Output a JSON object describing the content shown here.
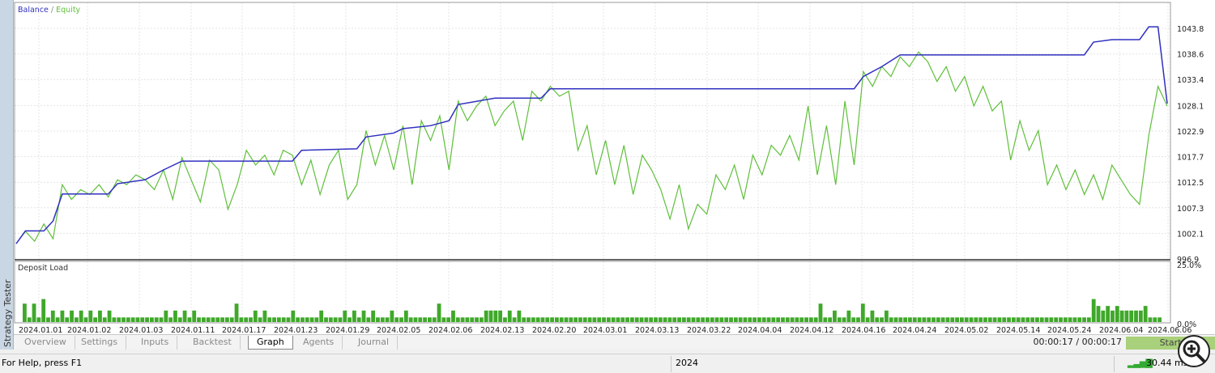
{
  "panel_title": "Strategy Tester",
  "legend": {
    "balance": "Balance",
    "sep": " / ",
    "equity": "Equity"
  },
  "colors": {
    "balance": "#3030c0",
    "equity": "#5fbf3a",
    "bars": "#3fa82a"
  },
  "chart_data": [
    {
      "type": "line",
      "title": "Balance / Equity",
      "yticks": [
        "1043.8",
        "1038.6",
        "1033.4",
        "1028.1",
        "1022.9",
        "1017.7",
        "1012.5",
        "1007.3",
        "1002.1",
        "996.9"
      ],
      "ylim": [
        996.9,
        1043.8
      ],
      "series": [
        {
          "name": "Equity",
          "values": [
            1000,
            1002.5,
            1000.5,
            1004,
            1001,
            1012,
            1009,
            1011,
            1010,
            1012,
            1009.5,
            1013,
            1012,
            1014,
            1013,
            1011,
            1015,
            1009,
            1017.5,
            1013,
            1008.5,
            1017,
            1015,
            1007,
            1012,
            1019,
            1016,
            1018,
            1014,
            1019,
            1018,
            1012,
            1017,
            1010,
            1016,
            1019,
            1009,
            1012,
            1023,
            1016,
            1022,
            1015,
            1024,
            1012,
            1025,
            1021,
            1026,
            1015,
            1029,
            1025,
            1028,
            1030,
            1024,
            1027,
            1029,
            1021,
            1031,
            1029,
            1032,
            1030,
            1031,
            1019,
            1024,
            1014,
            1021,
            1012,
            1020,
            1010,
            1018,
            1015,
            1011,
            1005,
            1012,
            1003,
            1008,
            1006,
            1014,
            1011,
            1016,
            1009,
            1018,
            1014,
            1020,
            1018,
            1022,
            1017,
            1028,
            1014,
            1024,
            1012,
            1029,
            1016,
            1035,
            1032,
            1036,
            1034,
            1038,
            1036,
            1039,
            1037,
            1033,
            1036,
            1031,
            1034,
            1028,
            1032,
            1027,
            1029,
            1017,
            1025,
            1019,
            1023,
            1012,
            1016,
            1011,
            1015,
            1010,
            1014,
            1009,
            1016,
            1013,
            1010,
            1008,
            1022,
            1032,
            1028
          ]
        },
        {
          "name": "Balance",
          "points": [
            [
              0,
              1000
            ],
            [
              1,
              1002.6
            ],
            [
              3,
              1002.6
            ],
            [
              4,
              1004.6
            ],
            [
              5,
              1010.1
            ],
            [
              10,
              1010.1
            ],
            [
              11,
              1012.2
            ],
            [
              14,
              1013
            ],
            [
              16,
              1015
            ],
            [
              18,
              1016.8
            ],
            [
              30,
              1016.8
            ],
            [
              31,
              1019
            ],
            [
              37,
              1019.3
            ],
            [
              38,
              1021.7
            ],
            [
              41,
              1022.5
            ],
            [
              42,
              1023.4
            ],
            [
              45,
              1024
            ],
            [
              47,
              1025
            ],
            [
              48,
              1028.3
            ],
            [
              52,
              1029.6
            ],
            [
              57,
              1029.6
            ],
            [
              58,
              1031.5
            ],
            [
              91,
              1031.5
            ],
            [
              92,
              1034
            ],
            [
              94,
              1036
            ],
            [
              96,
              1038.4
            ],
            [
              116,
              1038.4
            ],
            [
              117,
              1041
            ],
            [
              119,
              1041.5
            ],
            [
              122,
              1041.5
            ],
            [
              123,
              1044.1
            ],
            [
              124,
              1044.1
            ],
            [
              125,
              1028.5
            ]
          ]
        }
      ]
    },
    {
      "type": "bar",
      "title": "Deposit Load",
      "yticks": [
        "25.0%",
        "0.0%"
      ],
      "ylim": [
        0,
        25
      ],
      "values": [
        8,
        2,
        8,
        2,
        10,
        2,
        5,
        2,
        5,
        2,
        5,
        2,
        5,
        2,
        5,
        2,
        5,
        2,
        5,
        2,
        2,
        2,
        2,
        2,
        2,
        2,
        2,
        2,
        2,
        2,
        5,
        2,
        5,
        2,
        5,
        2,
        5,
        2,
        2,
        2,
        2,
        2,
        2,
        2,
        2,
        8,
        2,
        2,
        2,
        5,
        2,
        5,
        2,
        2,
        2,
        2,
        2,
        5,
        2,
        2,
        2,
        2,
        2,
        5,
        2,
        2,
        2,
        2,
        5,
        2,
        5,
        2,
        5,
        2,
        5,
        2,
        2,
        2,
        5,
        2,
        2,
        5,
        2,
        2,
        2,
        2,
        2,
        2,
        8,
        2,
        2,
        5,
        2,
        2,
        2,
        2,
        2,
        2,
        5,
        5,
        5,
        5,
        2,
        5,
        2,
        5,
        2,
        2,
        2,
        2,
        2,
        2,
        2,
        2,
        2,
        2,
        2,
        2,
        2,
        2,
        2,
        2,
        2,
        2,
        2,
        2,
        2,
        2,
        2,
        2,
        2,
        2,
        2,
        2,
        2,
        2,
        2,
        2,
        2,
        2,
        2,
        2,
        2,
        2,
        2,
        2,
        2,
        2,
        2,
        2,
        2,
        2,
        2,
        2,
        2,
        2,
        2,
        2,
        2,
        2,
        2,
        2,
        2,
        2,
        2,
        2,
        2,
        2,
        2,
        8,
        2,
        2,
        5,
        2,
        2,
        5,
        2,
        2,
        8,
        2,
        5,
        2,
        2,
        5,
        2,
        2,
        2,
        2,
        2,
        2,
        2,
        2,
        2,
        2,
        2,
        2,
        2,
        2,
        2,
        2,
        2,
        2,
        2,
        2,
        2,
        2,
        2,
        2,
        2,
        2,
        2,
        2,
        2,
        2,
        2,
        2,
        2,
        2,
        2,
        2,
        2,
        2,
        2,
        2,
        2,
        2,
        2,
        10,
        7,
        5,
        7,
        5,
        7,
        5,
        5,
        5,
        5,
        5,
        7,
        2,
        2,
        2
      ]
    },
    {
      "type": "axis",
      "xticks": [
        "2024.01.01",
        "2024.01.02",
        "2024.01.03",
        "2024.01.11",
        "2024.01.17",
        "2024.01.23",
        "2024.01.29",
        "2024.02.05",
        "2024.02.06",
        "2024.02.13",
        "2024.02.20",
        "2024.03.01",
        "2024.03.13",
        "2024.03.22",
        "2024.04.04",
        "2024.04.12",
        "2024.04.16",
        "2024.04.24",
        "2024.05.02",
        "2024.05.14",
        "2024.05.24",
        "2024.06.04",
        "2024.06.06"
      ]
    }
  ],
  "tabs": [
    "Overview",
    "Settings",
    "Inputs",
    "Backtest",
    "Graph",
    "Agents",
    "Journal"
  ],
  "active_tab": "Graph",
  "times": "00:00:17 / 00:00:17",
  "start_label": "Start",
  "status": {
    "help": "For Help, press F1",
    "year": "2024",
    "ping": "30.44 ms"
  }
}
